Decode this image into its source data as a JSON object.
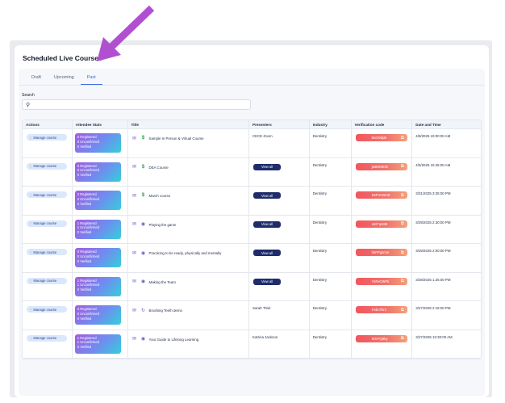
{
  "page_title": "Scheduled Live Courses",
  "collapse_icon": "chevron-up-icon",
  "annotation_arrow_color": "#b14fd1",
  "tabs": [
    {
      "label": "Draft"
    },
    {
      "label": "Upcoming"
    },
    {
      "label": "Past",
      "active": true
    }
  ],
  "search": {
    "label": "Search",
    "placeholder": "",
    "value": ""
  },
  "columns": [
    "Actions",
    "Attendee Stats",
    "Title",
    "Presenters",
    "Industry",
    "Verification code",
    "Date and Time"
  ],
  "manage_label": "Manage course",
  "view_all_label": "View all",
  "rows": [
    {
      "registered": "0 Registered",
      "unconfirmed": "0 Unconfirmed",
      "verified": "0 Verified",
      "title": "Sample In Person & Virtual Course",
      "presenter": "CECE Zoom",
      "industry": "Dentistry",
      "code": "bIvO9dpB",
      "date": "4/8/2025 10:00:00 AM",
      "icon": "dollar"
    },
    {
      "registered": "0 Registered",
      "unconfirmed": "0 Unconfirmed",
      "verified": "0 Verified",
      "title": "DEA Course",
      "presenter": "",
      "industry": "Dentistry",
      "code": "jwBW9ESk",
      "date": "4/5/2025 10:45:00 AM",
      "icon": "dollar"
    },
    {
      "registered": "2 Registered",
      "unconfirmed": "2 Unconfirmed",
      "verified": "0 Verified",
      "title": "March course",
      "presenter": "",
      "industry": "Dentistry",
      "code": "DsPVUBmD",
      "date": "3/31/2025 3:25:00 PM",
      "icon": "dollar"
    },
    {
      "registered": "1 Registered",
      "unconfirmed": "1 Unconfirmed",
      "verified": "0 Verified",
      "title": "Playing the game",
      "presenter": "",
      "industry": "Dentistry",
      "code": "v62TqN9B",
      "date": "3/29/2025 2:30:00 PM",
      "icon": "camera"
    },
    {
      "registered": "0 Registered",
      "unconfirmed": "0 Unconfirmed",
      "verified": "0 Verified",
      "title": "Practicing to be ready, physically and mentally",
      "presenter": "",
      "industry": "Dentistry",
      "code": "h5PPgsmm",
      "date": "3/29/2025 2:00:00 PM",
      "icon": "camera"
    },
    {
      "registered": "1 Registered",
      "unconfirmed": "1 Unconfirmed",
      "verified": "0 Verified",
      "title": "Making the Team",
      "presenter": "",
      "industry": "Dentistry",
      "code": "YsFeCWPk",
      "date": "3/28/2025 1:25:00 PM",
      "icon": "camera"
    },
    {
      "registered": "0 Registered",
      "unconfirmed": "0 Unconfirmed",
      "verified": "0 Verified",
      "title": "Brushing Teeth demo",
      "presenter": "Sarah Thiel",
      "industry": "Dentistry",
      "code": "FSboTkr2",
      "date": "3/27/2025 2:18:00 PM",
      "icon": "refresh"
    },
    {
      "registered": "1 Registered",
      "unconfirmed": "1 Unconfirmed",
      "verified": "0 Verified",
      "title": "Your Guide to Lifelong Learning",
      "presenter": "Katrina Jackson",
      "industry": "Dentistry",
      "code": "9OrPQBky",
      "date": "3/27/2025 10:30:00 AM",
      "icon": "camera"
    }
  ]
}
